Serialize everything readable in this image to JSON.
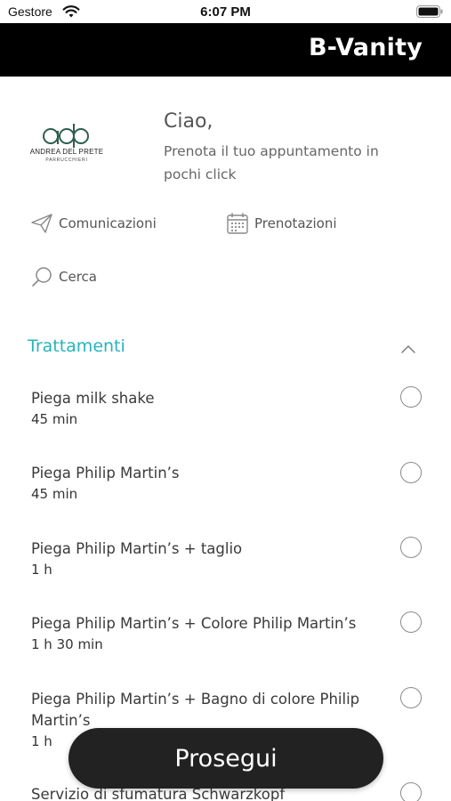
{
  "status_bar": {
    "carrier": "Gestore",
    "time": "6:07 PM"
  },
  "header": {
    "title": "B-Vanity"
  },
  "salon": {
    "logo_mark": "adp",
    "logo_name": "ANDREA DEL PRETE",
    "logo_sub": "PARRUCCHIERI",
    "greeting": "Ciao,",
    "tagline": "Prenota il tuo appuntamento in pochi click"
  },
  "actions": {
    "communications": {
      "label": "Comunicazioni",
      "icon": "paper-plane-icon"
    },
    "bookings": {
      "label": "Prenotazioni",
      "icon": "calendar-icon"
    },
    "search": {
      "label": "Cerca",
      "icon": "search-icon"
    }
  },
  "section": {
    "title": "Trattamenti",
    "expanded": true
  },
  "treatments": [
    {
      "name": "Piega milk shake",
      "duration": "45 min",
      "selected": false
    },
    {
      "name": "Piega Philip Martin’s",
      "duration": "45 min",
      "selected": false
    },
    {
      "name": "Piega Philip Martin’s + taglio",
      "duration": "1 h",
      "selected": false
    },
    {
      "name": "Piega Philip Martin’s + Colore Philip Martin’s",
      "duration": "1 h 30 min",
      "selected": false
    },
    {
      "name": "Piega Philip Martin’s + Bagno di colore Philip Martin’s",
      "duration": "1 h",
      "selected": false
    },
    {
      "name": "Servizio di sfumatura Schwarzkopf",
      "duration": "",
      "selected": false
    }
  ],
  "cta": {
    "label": "Prosegui"
  },
  "colors": {
    "accent": "#27b3bd",
    "header_bg": "#000000",
    "cta_bg": "#222222"
  }
}
